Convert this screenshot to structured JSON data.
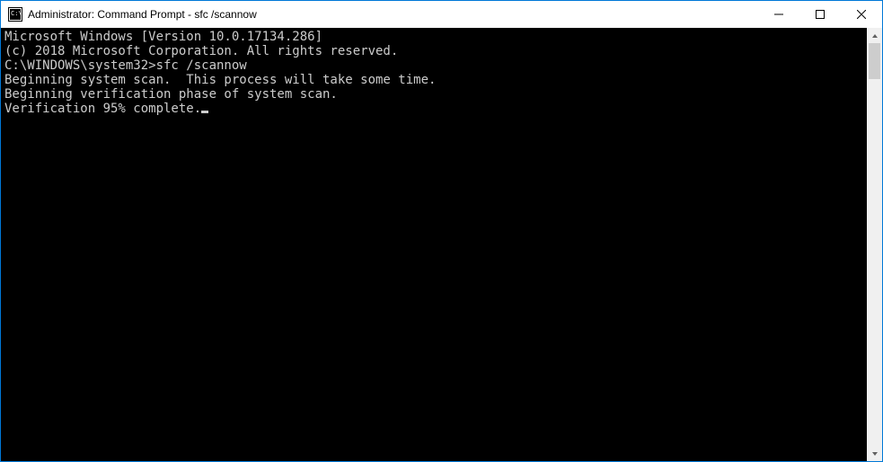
{
  "window": {
    "title": "Administrator: Command Prompt - sfc  /scannow"
  },
  "console": {
    "lines": {
      "version": "Microsoft Windows [Version 10.0.17134.286]",
      "copyright": "(c) 2018 Microsoft Corporation. All rights reserved.",
      "blank1": "",
      "prompt_path": "C:\\WINDOWS\\system32>",
      "prompt_cmd": "sfc /scannow",
      "blank2": "",
      "scan_begin": "Beginning system scan.  This process will take some time.",
      "blank3": "",
      "verify_begin": "Beginning verification phase of system scan.",
      "verify_progress": "Verification 95% complete."
    }
  }
}
